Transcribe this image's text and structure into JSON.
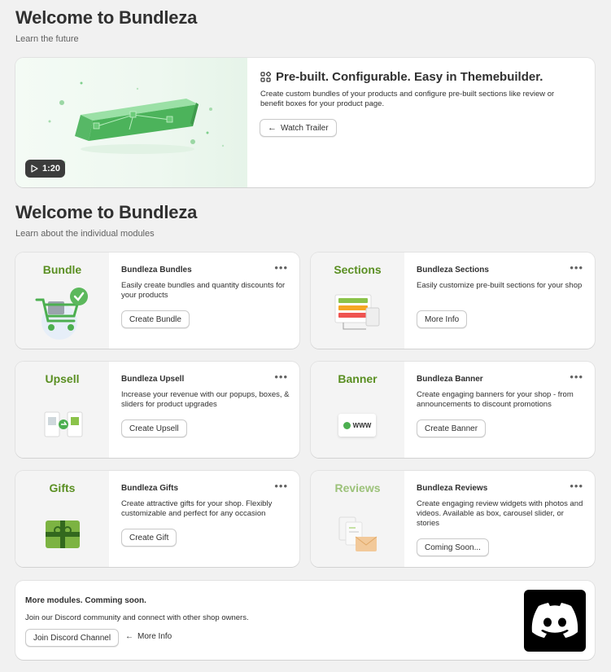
{
  "header": {
    "title": "Welcome to Bundleza",
    "subtitle": "Learn the future"
  },
  "hero": {
    "duration": "1:20",
    "title": "Pre-built. Configurable. Easy in Themebuilder.",
    "description": "Create custom bundles of your products and configure pre-built sections like review or benefit boxes for your product page.",
    "button": "Watch Trailer"
  },
  "modules_section": {
    "title": "Welcome to Bundleza",
    "subtitle": "Learn about the individual modules"
  },
  "modules": [
    {
      "name": "Bundle",
      "title": "Bundleza Bundles",
      "description": "Easily create bundles and quantity discounts for your products",
      "button": "Create Bundle",
      "more": "•••",
      "name_color": "#5a8f22"
    },
    {
      "name": "Sections",
      "title": "Bundleza Sections",
      "description": "Easily customize pre-built sections for your shop",
      "button": "More Info",
      "more": "•••",
      "name_color": "#5a8f22"
    },
    {
      "name": "Upsell",
      "title": "Bundleza Upsell",
      "description": "Increase your revenue with our popups, boxes, & sliders for product upgrades",
      "button": "Create Upsell",
      "more": "•••",
      "name_color": "#5a8f22"
    },
    {
      "name": "Banner",
      "title": "Bundleza Banner",
      "description": "Create engaging banners for your shop - from announcements to discount promotions",
      "button": "Create Banner",
      "more": "•••",
      "name_color": "#5a8f22"
    },
    {
      "name": "Gifts",
      "title": "Bundleza Gifts",
      "description": "Create attractive gifts for your shop. Flexibly customizable and perfect for any occasion",
      "button": "Create Gift",
      "more": "•••",
      "name_color": "#5a8f22"
    },
    {
      "name": "Reviews",
      "title": "Bundleza Reviews",
      "description": "Create engaging review widgets with photos and videos. Available as box, carousel slider, or stories",
      "button": "Coming Soon...",
      "more": "•••",
      "name_color": "#9cc27a"
    }
  ],
  "banner_widget": {
    "www": "WWW"
  },
  "footer": {
    "title": "More modules. Comming soon.",
    "description": "Join our Discord community and connect with other shop owners.",
    "discord_button": "Join Discord Channel",
    "more_info": "More Info"
  },
  "colors": {
    "accent_green": "#5a8f22",
    "discord_bg": "#000000"
  },
  "icons": {
    "play": "play-icon",
    "apps": "apps-icon",
    "arrow": "arrow-left-icon",
    "discord": "discord-icon"
  }
}
